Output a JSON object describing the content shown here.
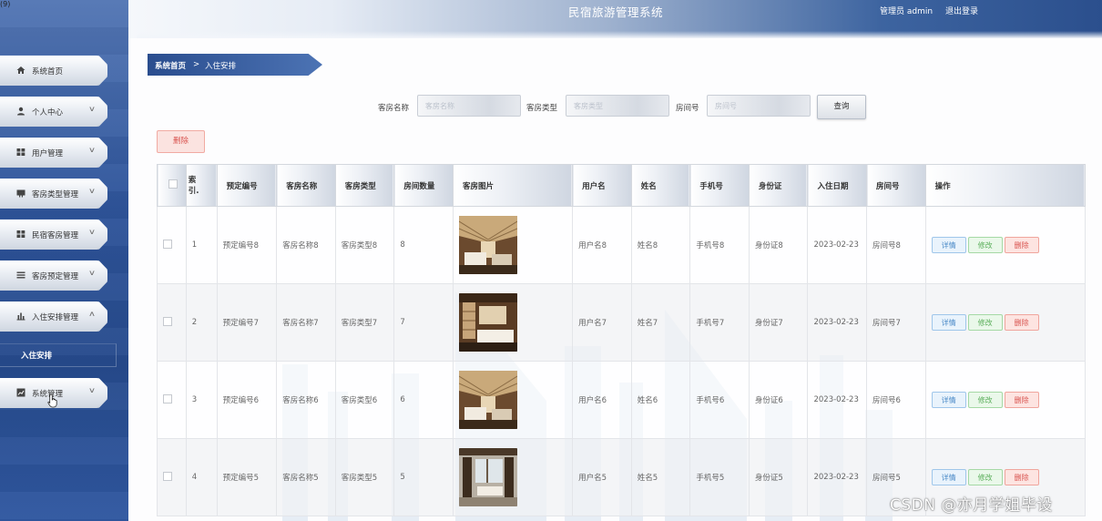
{
  "header": {
    "title": "民宿旅游管理系统",
    "admin_label": "管理员 admin",
    "logout_label": "退出登录",
    "corner_mark": "(9)"
  },
  "sidebar": {
    "items": [
      {
        "label": "系统首页",
        "icon": "home-icon"
      },
      {
        "label": "个人中心",
        "icon": "user-icon"
      },
      {
        "label": "用户管理",
        "icon": "grid-icon"
      },
      {
        "label": "客房类型管理",
        "icon": "card-icon"
      },
      {
        "label": "民宿客房管理",
        "icon": "grid-icon"
      },
      {
        "label": "客房预定管理",
        "icon": "list-icon"
      },
      {
        "label": "入住安排管理",
        "icon": "bar-chart-icon"
      },
      {
        "label": "系统管理",
        "icon": "chart-icon"
      }
    ],
    "active_subitem": "入住安排"
  },
  "breadcrumb": {
    "home": "系统首页",
    "separator": ">",
    "current": "入住安排"
  },
  "search": {
    "room_name_label": "客房名称",
    "room_name_placeholder": "客房名称",
    "room_type_label": "客房类型",
    "room_type_placeholder": "客房类型",
    "room_no_label": "房间号",
    "room_no_placeholder": "房间号",
    "query_label": "查询"
  },
  "bulk_delete_label": "删除",
  "table": {
    "headers": [
      "索引",
      "预定编号",
      "客房名称",
      "客房类型",
      "房间数量",
      "客房图片",
      "用户名",
      "姓名",
      "手机号",
      "身份证",
      "入住日期",
      "房间号",
      "操作"
    ],
    "index_header": "索\n引.",
    "rows": [
      {
        "index": "1",
        "booking_no": "预定编号8",
        "room_name": "客房名称8",
        "room_type": "客房类型8",
        "room_count": "8",
        "username": "用户名8",
        "name": "姓名8",
        "phone": "手机号8",
        "id_card": "身份证8",
        "checkin_date": "2023-02-23",
        "room_no": "房间号8"
      },
      {
        "index": "2",
        "booking_no": "预定编号7",
        "room_name": "客房名称7",
        "room_type": "客房类型7",
        "room_count": "7",
        "username": "用户名7",
        "name": "姓名7",
        "phone": "手机号7",
        "id_card": "身份证7",
        "checkin_date": "2023-02-23",
        "room_no": "房间号7"
      },
      {
        "index": "3",
        "booking_no": "预定编号6",
        "room_name": "客房名称6",
        "room_type": "客房类型6",
        "room_count": "6",
        "username": "用户名6",
        "name": "姓名6",
        "phone": "手机号6",
        "id_card": "身份证6",
        "checkin_date": "2023-02-23",
        "room_no": "房间号6"
      },
      {
        "index": "4",
        "booking_no": "预定编号5",
        "room_name": "客房名称5",
        "room_type": "客房类型5",
        "room_count": "5",
        "username": "用户名5",
        "name": "姓名5",
        "phone": "手机号5",
        "id_card": "身份证5",
        "checkin_date": "2023-02-23",
        "room_no": "房间号5"
      }
    ],
    "actions": {
      "detail": "详情",
      "edit": "修改",
      "delete": "删除"
    }
  },
  "watermark": "CSDN @亦月学姐毕设",
  "colors": {
    "sidebar": "#2e549a",
    "accent": "#3d64a0",
    "delete": "#d9534f",
    "detail": "#4a8ac7",
    "edit": "#5aae5a"
  }
}
